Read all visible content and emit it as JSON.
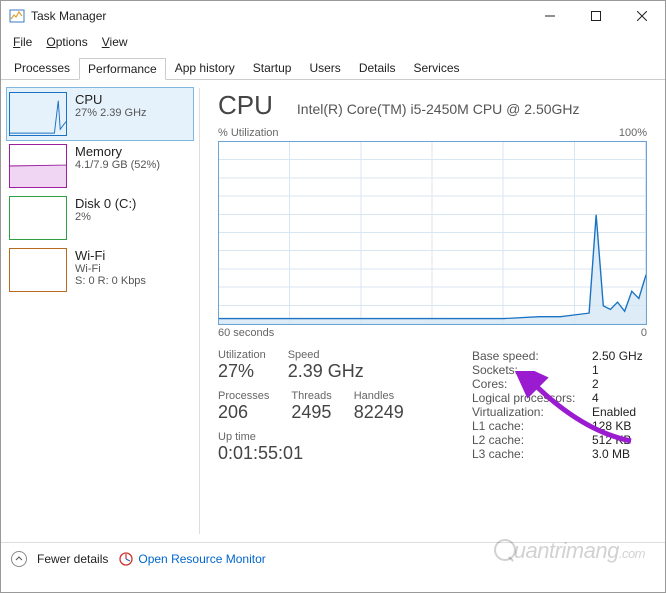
{
  "window": {
    "title": "Task Manager"
  },
  "menu": {
    "file": "File",
    "options": "Options",
    "view": "View"
  },
  "tabs": {
    "processes": "Processes",
    "performance": "Performance",
    "app_history": "App history",
    "startup": "Startup",
    "users": "Users",
    "details": "Details",
    "services": "Services"
  },
  "sidebar": {
    "cpu": {
      "title": "CPU",
      "sub": "27% 2.39 GHz"
    },
    "memory": {
      "title": "Memory",
      "sub": "4.1/7.9 GB (52%)"
    },
    "disk": {
      "title": "Disk 0 (C:)",
      "sub": "2%"
    },
    "wifi": {
      "title": "Wi-Fi",
      "sub": "Wi-Fi",
      "sub2": "S: 0 R: 0 Kbps"
    }
  },
  "main": {
    "heading": "CPU",
    "cpu_name": "Intel(R) Core(TM) i5-2450M CPU @ 2.50GHz",
    "util_label": "% Utilization",
    "util_max": "100%",
    "time_left": "60 seconds",
    "time_right": "0",
    "stats": {
      "utilization": {
        "label": "Utilization",
        "value": "27%"
      },
      "speed": {
        "label": "Speed",
        "value": "2.39 GHz"
      },
      "processes": {
        "label": "Processes",
        "value": "206"
      },
      "threads": {
        "label": "Threads",
        "value": "2495"
      },
      "handles": {
        "label": "Handles",
        "value": "82249"
      },
      "uptime": {
        "label": "Up time",
        "value": "0:01:55:01"
      }
    },
    "right": {
      "base_speed": {
        "k": "Base speed:",
        "v": "2.50 GHz"
      },
      "sockets": {
        "k": "Sockets:",
        "v": "1"
      },
      "cores": {
        "k": "Cores:",
        "v": "2"
      },
      "logical": {
        "k": "Logical processors:",
        "v": "4"
      },
      "virt": {
        "k": "Virtualization:",
        "v": "Enabled"
      },
      "l1": {
        "k": "L1 cache:",
        "v": "128 KB"
      },
      "l2": {
        "k": "L2 cache:",
        "v": "512 KB"
      },
      "l3": {
        "k": "L3 cache:",
        "v": "3.0 MB"
      }
    }
  },
  "footer": {
    "fewer": "Fewer details",
    "resmon": "Open Resource Monitor"
  },
  "chart_data": {
    "type": "line",
    "title": "% Utilization",
    "xlabel": "60 seconds",
    "ylabel": "%",
    "ylim": [
      0,
      100
    ],
    "x_seconds_ago": [
      60,
      55,
      50,
      45,
      40,
      35,
      30,
      25,
      20,
      15,
      12,
      10,
      8,
      7,
      6,
      5,
      4,
      3,
      2,
      1,
      0
    ],
    "values": [
      3,
      3,
      3,
      3,
      3,
      3,
      3,
      3,
      3,
      4,
      4,
      5,
      6,
      60,
      10,
      8,
      12,
      7,
      18,
      14,
      27
    ]
  }
}
